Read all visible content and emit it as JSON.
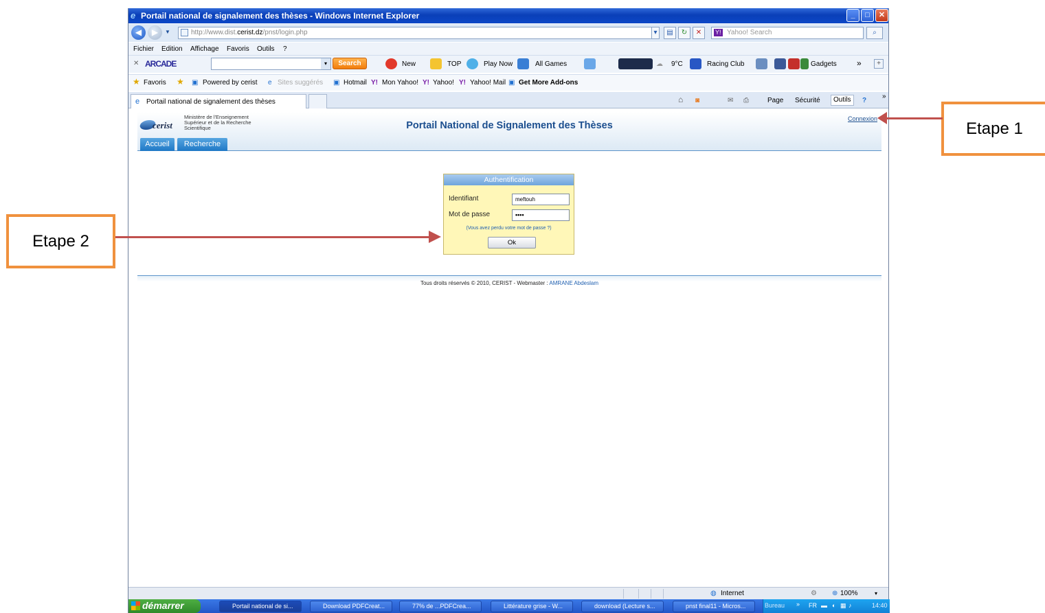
{
  "window": {
    "title": "Portail national de signalement des thèses - Windows Internet Explorer",
    "min": "_",
    "max": "□",
    "close": "✕"
  },
  "address": {
    "url_prefix": "http://www.dist.",
    "url_domain": "cerist.dz",
    "url_path": "/pnst/login.php",
    "search_placeholder": "Yahoo! Search",
    "yahoo_badge": "Y!"
  },
  "menu": [
    "Fichier",
    "Edition",
    "Affichage",
    "Favoris",
    "Outils",
    "?"
  ],
  "toolbar": {
    "brand": "ARCADE",
    "search_button": "Search",
    "items": [
      "New",
      "TOP",
      "Play Now",
      "All Games",
      "9°C",
      "Racing Club",
      "Gadgets"
    ],
    "more": "»"
  },
  "favorites_bar": {
    "favoris": "Favoris",
    "items": [
      "Powered by cerist",
      "Sites suggérés",
      "Hotmail",
      "Mon Yahoo!",
      "Yahoo!",
      "Yahoo! Mail",
      "Get More Add-ons"
    ]
  },
  "tabs": {
    "active_tab": "Portail national de signalement des thèses"
  },
  "command_bar": [
    "Page",
    "Sécurité",
    "Outils"
  ],
  "page": {
    "ministry": [
      "Ministère de l'Enseignement",
      "Supérieur et de la Recherche",
      "Scientifique"
    ],
    "logo_text": "cerist",
    "title": "Portail National de Signalement des Thèses",
    "connexion": "Connexion",
    "nav_tabs": [
      "Accueil",
      "Recherche"
    ],
    "auth": {
      "header": "Authentification",
      "id_label": "Identifiant",
      "id_value": "meftouh",
      "pw_label": "Mot de passe",
      "pw_value": "••••",
      "lost_link": "(Vous avez perdu votre mot de passe ?)",
      "ok": "Ok"
    },
    "footer": {
      "copyright": "Tous droits réservés © 2010, CERIST - Webmaster : ",
      "author": "AMRANE Abdeslam"
    }
  },
  "status": {
    "zone": "Internet",
    "zoom": "100%"
  },
  "taskbar": {
    "start": "démarrer",
    "tasks": [
      "Portail national de si...",
      "Download PDFCreat...",
      "77% de ...PDFCrea...",
      "Littérature grise - W...",
      "download (Lecture s...",
      "pnst final11 - Micros..."
    ],
    "bureau": "Bureau",
    "lang": "FR",
    "clock": "14:40"
  },
  "annotations": {
    "step1": "Etape 1",
    "step2": "Etape 2"
  },
  "colors": {
    "callout_border": "#f0913e",
    "arrow": "#c0504d",
    "title_blue": "#1c4f8f",
    "auth_bg": "#fff7b8"
  }
}
